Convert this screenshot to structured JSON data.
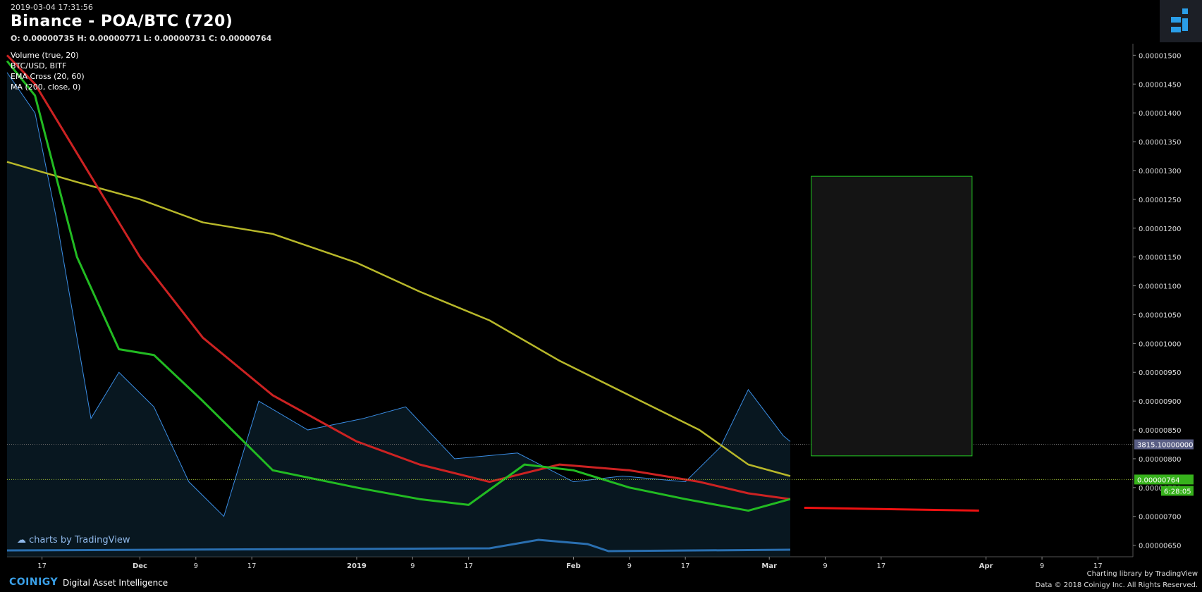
{
  "header": {
    "timestamp": "2019-03-04 17:31:56",
    "title": "Binance - POA/BTC (720)",
    "ohlc": "O: 0.00000735 H: 0.00000771 L: 0.00000731 C: 0.00000764"
  },
  "legend": [
    "Volume (true, 20)",
    "BTC/USD, BITF",
    "EMA Cross (20, 60)",
    "MA (200, close, 0)"
  ],
  "footer": {
    "tv_logo": "charts by TradingView",
    "brand": "COINIGY",
    "tagline": "Digital Asset Intelligence",
    "credit_line1": "Charting library by  TradingView",
    "credit_line2": "Data © 2018  Coinigy Inc. All Rights Reserved."
  },
  "colors": {
    "background": "#000000",
    "bull": "#44cc22",
    "bear": "#dd3344",
    "ema_fast": "#22bb22",
    "ema_slow": "#cc2222",
    "ma200": "#b8b82a",
    "btc_line": "#3a8ee6",
    "volume_ma": "#2a6fb0",
    "axis_text": "#dddddd"
  },
  "chart_data": {
    "type": "line",
    "price_axis": {
      "ticks": [
        "0.00001500",
        "0.00001450",
        "0.00001400",
        "0.00001350",
        "0.00001300",
        "0.00001250",
        "0.00001200",
        "0.00001150",
        "0.00001100",
        "0.00001050",
        "0.00001000",
        "0.00000950",
        "0.00000900",
        "0.00000850",
        "0.00000800",
        "0.00000750",
        "0.00000700",
        "0.00000650"
      ],
      "ylim": [
        6.3e-06,
        1.52e-05
      ]
    },
    "time_axis": {
      "labels": [
        "17",
        "Dec",
        "9",
        "17",
        "2019",
        "9",
        "17",
        "Feb",
        "9",
        "17",
        "Mar",
        "9",
        "17",
        "Apr",
        "9",
        "17"
      ],
      "xlim": [
        "2018-11-12",
        "2019-04-22"
      ],
      "label_dates": [
        "2018-11-17",
        "2018-12-01",
        "2018-12-09",
        "2018-12-17",
        "2019-01-01",
        "2019-01-09",
        "2019-01-17",
        "2019-02-01",
        "2019-02-09",
        "2019-02-17",
        "2019-03-01",
        "2019-03-09",
        "2019-03-17",
        "2019-04-01",
        "2019-04-09",
        "2019-04-17"
      ]
    },
    "price_tags": {
      "btc_usd": "3815.10000000",
      "last_price": "0.00000764",
      "countdown": "6:28:05"
    },
    "btc_line_level": 8.25e-06,
    "last_price_level": 7.64e-06,
    "series": [
      {
        "name": "MA (200, close, 0)",
        "x": [
          "2018-11-12",
          "2018-11-22",
          "2018-12-01",
          "2018-12-10",
          "2018-12-20",
          "2019-01-01",
          "2019-01-10",
          "2019-01-20",
          "2019-01-30",
          "2019-02-09",
          "2019-02-19",
          "2019-02-26",
          "2019-03-04"
        ],
        "values": [
          1.315e-05,
          1.28e-05,
          1.25e-05,
          1.21e-05,
          1.19e-05,
          1.14e-05,
          1.09e-05,
          1.04e-05,
          9.7e-06,
          9.1e-06,
          8.5e-06,
          7.9e-06,
          7.7e-06
        ]
      },
      {
        "name": "EMA Cross (20, 60) slow",
        "x": [
          "2018-11-12",
          "2018-11-16",
          "2018-11-22",
          "2018-12-01",
          "2018-12-10",
          "2018-12-20",
          "2019-01-01",
          "2019-01-10",
          "2019-01-20",
          "2019-01-30",
          "2019-02-09",
          "2019-02-19",
          "2019-02-26",
          "2019-03-04"
        ],
        "values": [
          1.5e-05,
          1.45e-05,
          1.33e-05,
          1.15e-05,
          1.01e-05,
          9.1e-06,
          8.3e-06,
          7.9e-06,
          7.6e-06,
          7.9e-06,
          7.8e-06,
          7.6e-06,
          7.4e-06,
          7.3e-06
        ]
      },
      {
        "name": "EMA Cross (20, 60) fast",
        "x": [
          "2018-11-12",
          "2018-11-16",
          "2018-11-22",
          "2018-11-28",
          "2018-12-03",
          "2018-12-10",
          "2018-12-20",
          "2019-01-01",
          "2019-01-10",
          "2019-01-17",
          "2019-01-25",
          "2019-02-01",
          "2019-02-09",
          "2019-02-17",
          "2019-02-26",
          "2019-03-04"
        ],
        "values": [
          1.49e-05,
          1.43e-05,
          1.15e-05,
          9.9e-06,
          9.8e-06,
          9e-06,
          7.8e-06,
          7.5e-06,
          7.3e-06,
          7.2e-06,
          7.9e-06,
          7.8e-06,
          7.5e-06,
          7.3e-06,
          7.1e-06,
          7.3e-06
        ]
      },
      {
        "name": "BTC/USD, BITF",
        "x": [
          "2018-11-12",
          "2018-11-16",
          "2018-11-19",
          "2018-11-24",
          "2018-11-28",
          "2018-12-03",
          "2018-12-08",
          "2018-12-13",
          "2018-12-18",
          "2018-12-25",
          "2019-01-02",
          "2019-01-08",
          "2019-01-15",
          "2019-01-24",
          "2019-02-01",
          "2019-02-08",
          "2019-02-17",
          "2019-02-22",
          "2019-02-26",
          "2019-03-03",
          "2019-03-04"
        ],
        "values": [
          1.47e-05,
          1.4e-05,
          1.22e-05,
          8.7e-06,
          9.5e-06,
          8.9e-06,
          7.6e-06,
          7e-06,
          9e-06,
          8.5e-06,
          8.7e-06,
          8.9e-06,
          8e-06,
          8.1e-06,
          7.6e-06,
          7.7e-06,
          7.6e-06,
          8.2e-06,
          9.2e-06,
          8.4e-06,
          8.3e-06
        ]
      }
    ],
    "drawings": {
      "rectangle": {
        "x": [
          "2019-03-07",
          "2019-03-30"
        ],
        "y": [
          8.05e-06,
          1.29e-05
        ]
      },
      "red_line": {
        "x": [
          "2019-03-06",
          "2019-03-31"
        ],
        "y": [
          7.15e-06,
          7.1e-06
        ]
      }
    }
  }
}
